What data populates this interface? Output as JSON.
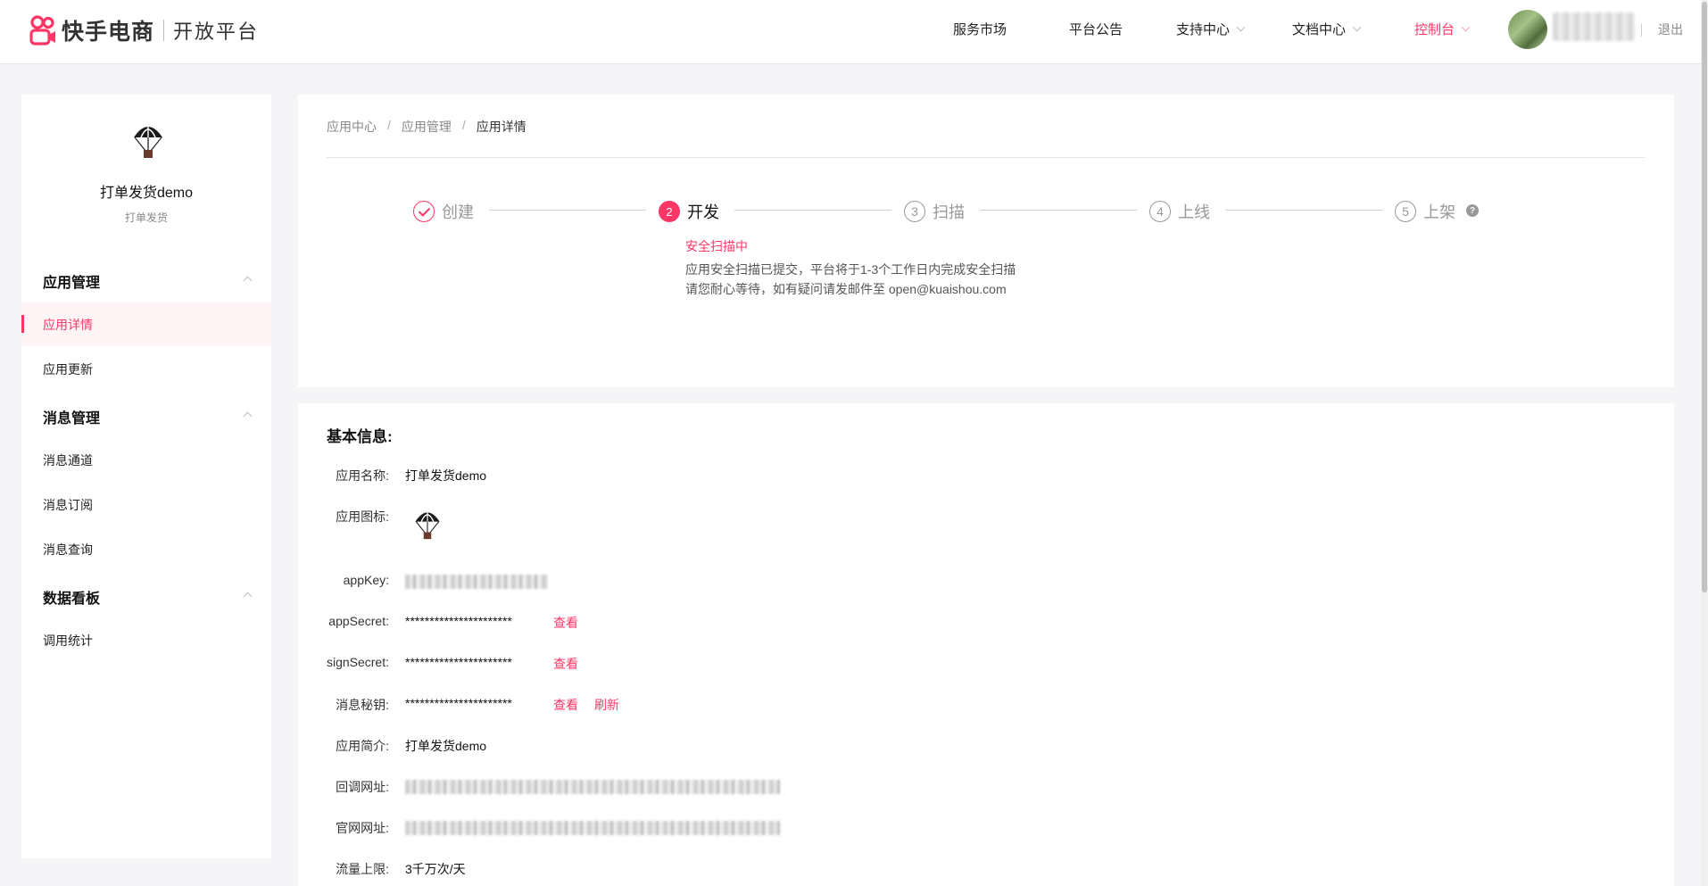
{
  "header": {
    "brand": "快手电商",
    "platform": "开放平台",
    "nav": [
      {
        "label": "服务市场",
        "has_caret": false
      },
      {
        "label": "平台公告",
        "has_caret": false
      },
      {
        "label": "支持中心",
        "has_caret": true
      },
      {
        "label": "文档中心",
        "has_caret": true
      },
      {
        "label": "控制台",
        "has_caret": true
      }
    ],
    "logout": "退出",
    "accent_color": "#fe3666"
  },
  "sidebar": {
    "app_name": "打单发货demo",
    "app_sub": "打单发货",
    "groups": [
      {
        "title": "应用管理",
        "items": [
          "应用详情",
          "应用更新"
        ]
      },
      {
        "title": "消息管理",
        "items": [
          "消息通道",
          "消息订阅",
          "消息查询"
        ]
      },
      {
        "title": "数据看板",
        "items": [
          "调用统计"
        ]
      }
    ]
  },
  "breadcrumb": [
    "应用中心",
    "应用管理",
    "应用详情"
  ],
  "steps": [
    {
      "num": "1",
      "label": "创建",
      "state": "done"
    },
    {
      "num": "2",
      "label": "开发",
      "state": "current"
    },
    {
      "num": "3",
      "label": "扫描",
      "state": "todo"
    },
    {
      "num": "4",
      "label": "上线",
      "state": "todo"
    },
    {
      "num": "5",
      "label": "上架",
      "state": "todo"
    }
  ],
  "scan": {
    "title": "安全扫描中",
    "desc": "应用安全扫描已提交，平台将于1-3个工作日内完成安全扫描 请您耐心等待，如有疑问请发邮件至 open@kuaishou.com"
  },
  "info": {
    "title": "基本信息:",
    "labels": {
      "name": "应用名称:",
      "icon": "应用图标:",
      "appkey": "appKey:",
      "appsecret": "appSecret:",
      "signsecret": "signSecret:",
      "msgkey": "消息秘钥:",
      "intro": "应用简介:",
      "callback": "回调网址:",
      "website": "官网网址:",
      "limit": "流量上限:"
    },
    "values": {
      "name": "打单发货demo",
      "appsecret": "**********************",
      "signsecret": "**********************",
      "msgkey": "**********************",
      "intro": "打单发货demo",
      "limit": "3千万次/天"
    },
    "view_label": "查看",
    "refresh_label": "刷新"
  }
}
